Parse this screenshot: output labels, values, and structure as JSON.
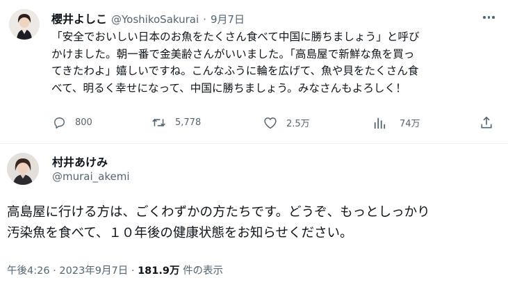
{
  "original_tweet": {
    "display_name": "櫻井よしこ",
    "handle": "@YoshikoSakurai",
    "separator": "·",
    "date": "9月7日",
    "text_lines": [
      "「安全でおいしい日本のお魚をたくさん食べて中国に勝ちましょう」と呼び",
      "かけました。朝一番で金美齢さんがいいました。「高島屋で新鮮な魚を買っ",
      "てきたわよ」嬉しいですね。こんなふうに輪を広げて、魚や貝をたくさん食",
      "べて、明るく幸せになって、中国に勝ちましょう。みなさんもよろしく！"
    ],
    "actions": {
      "reply_count": "800",
      "retweet_count": "5,778",
      "like_count": "2.5万",
      "view_count": "74万"
    },
    "icons": {
      "more": "more-dots-icon",
      "reply": "reply-icon",
      "retweet": "retweet-icon",
      "like": "heart-icon",
      "views": "views-bar-icon",
      "share": "share-icon"
    }
  },
  "reply_tweet": {
    "display_name": "村井あけみ",
    "handle": "@murai_akemi",
    "text_lines": [
      "高島屋に行ける方は、ごくわずかの方たちです。どうぞ、もっとしっかり",
      "汚染魚を食べて、１０年後の健康状態をお知らせください。"
    ],
    "timestamp": "午後4:26 · 2023年9月7日 ·",
    "view_count": "181.9万",
    "view_label": "件の表示"
  },
  "colors": {
    "text": "#0f1419",
    "secondary": "#536471",
    "divider": "#eff3f4"
  }
}
